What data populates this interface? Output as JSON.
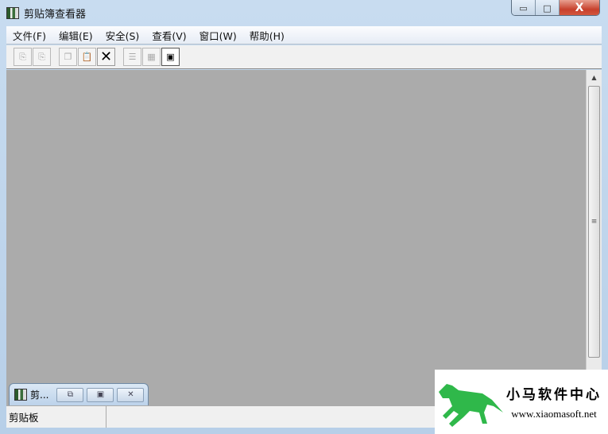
{
  "window": {
    "title": "剪贴簿查看器",
    "minimize": "▭",
    "maximize": "□",
    "close": "X"
  },
  "menu": [
    "文件(F)",
    "编辑(E)",
    "安全(S)",
    "查看(V)",
    "窗口(W)",
    "帮助(H)"
  ],
  "toolbar": {
    "delete": "✕"
  },
  "child_window": {
    "title": "剪..."
  },
  "status": {
    "left": "剪贴板",
    "right": ""
  },
  "watermark": {
    "name": "小马软件中心",
    "url": "www.xiaomasoft.net"
  }
}
